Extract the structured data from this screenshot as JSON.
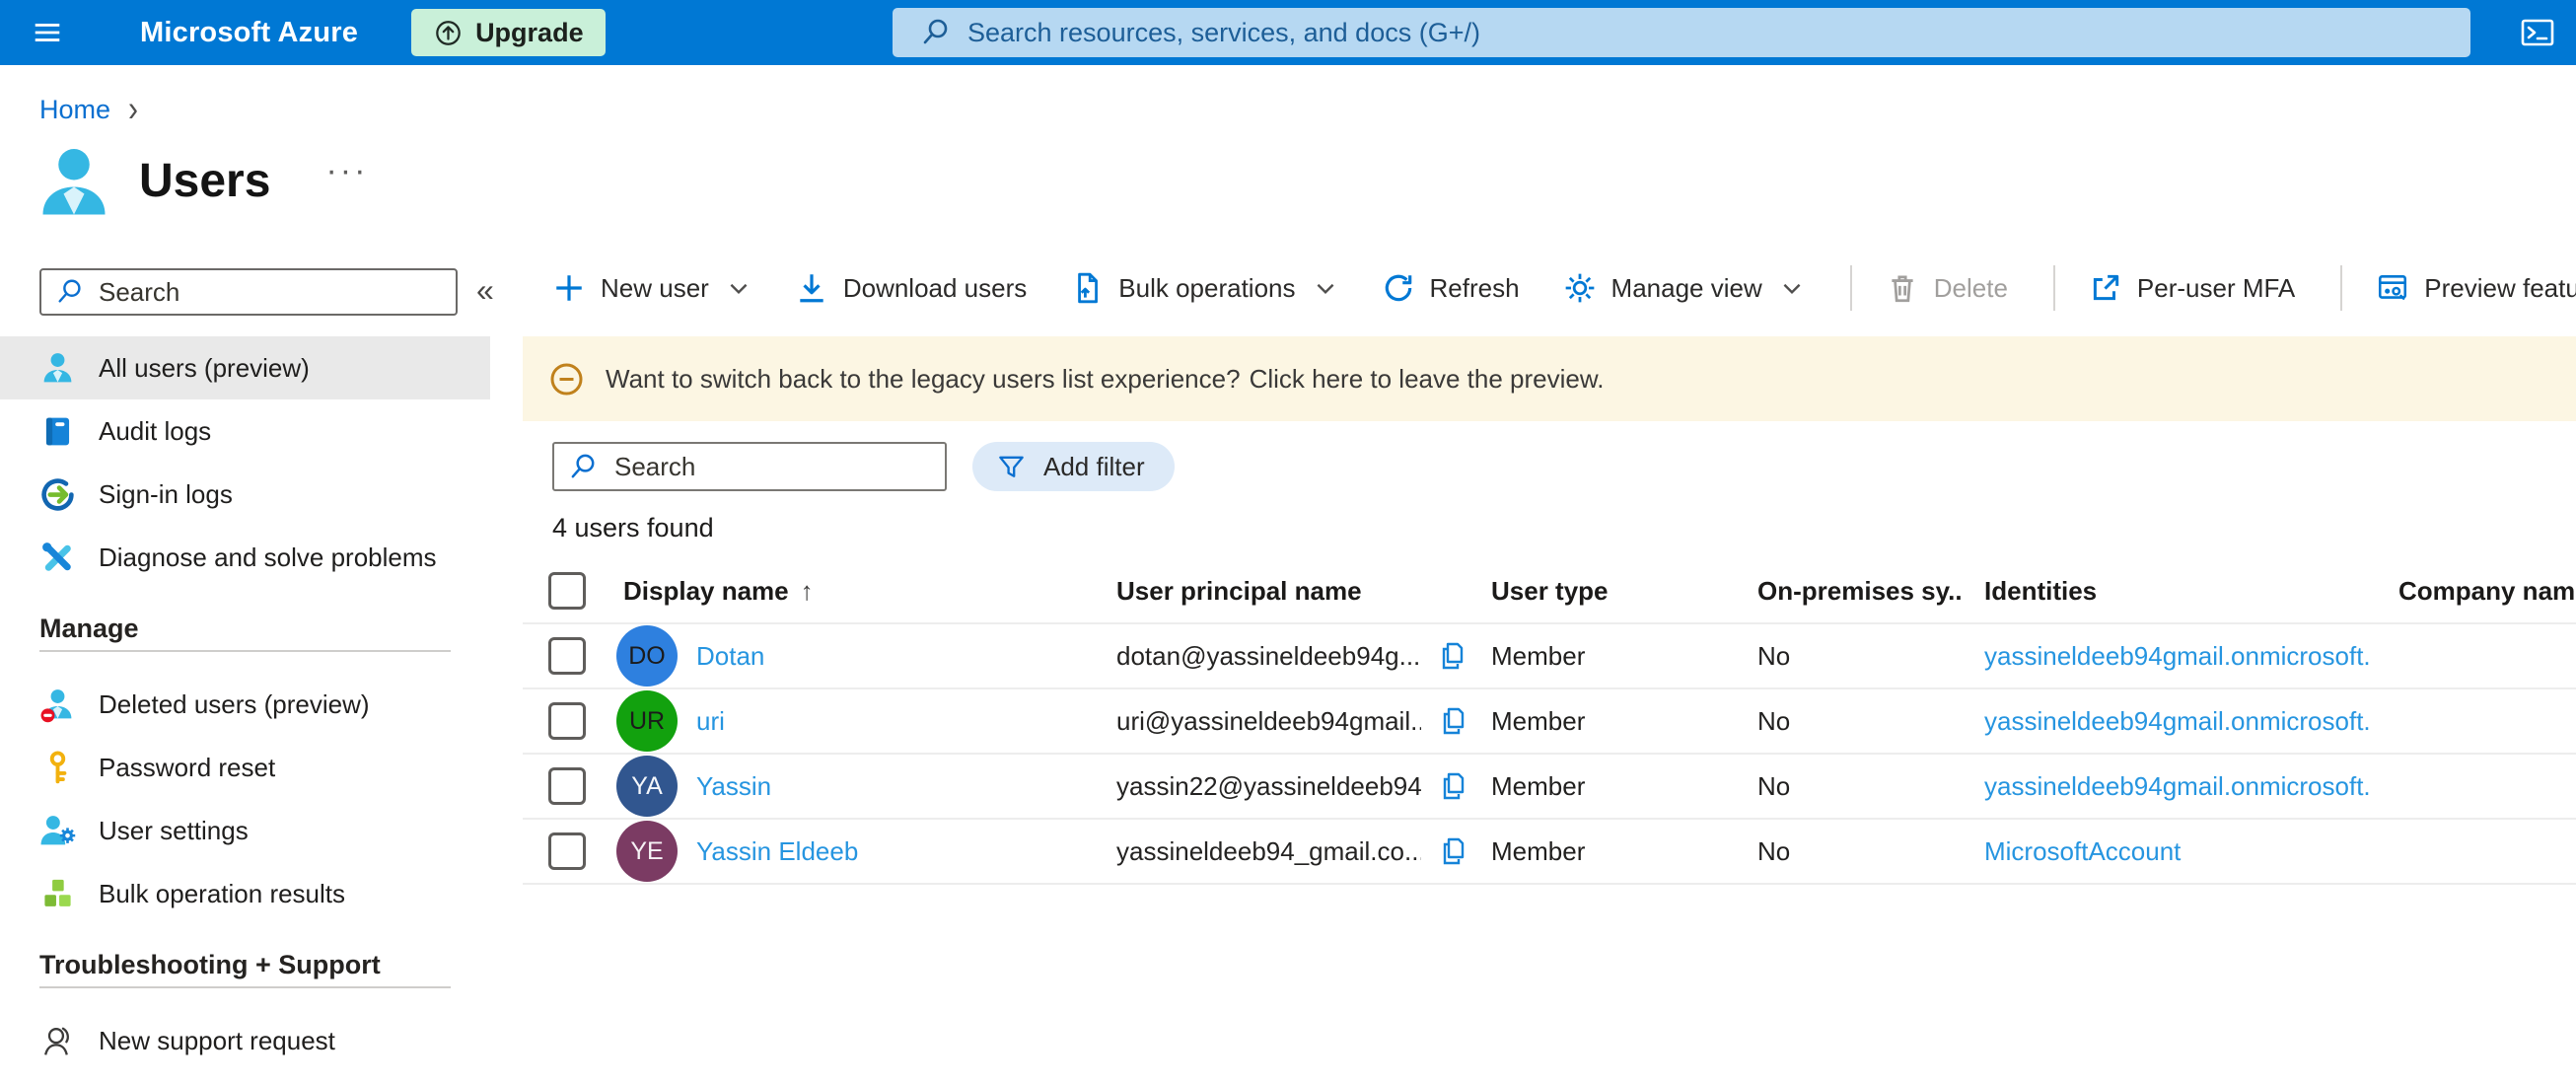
{
  "topbar": {
    "brand": "Microsoft Azure",
    "upgrade_label": "Upgrade",
    "search_placeholder": "Search resources, services, and docs (G+/)"
  },
  "breadcrumb": {
    "home": "Home",
    "separator": "›"
  },
  "page": {
    "title": "Users",
    "menu_glyph": "···"
  },
  "sidebar": {
    "search_placeholder": "Search",
    "collapse_glyph": "«",
    "primary_items": [
      {
        "label": "All users (preview)",
        "icon": "all-users-icon",
        "selected": true
      },
      {
        "label": "Audit logs",
        "icon": "audit-logs-icon"
      },
      {
        "label": "Sign-in logs",
        "icon": "sign-in-logs-icon"
      },
      {
        "label": "Diagnose and solve problems",
        "icon": "diagnose-icon"
      }
    ],
    "manage_header": "Manage",
    "manage_items": [
      {
        "label": "Deleted users (preview)",
        "icon": "deleted-users-icon"
      },
      {
        "label": "Password reset",
        "icon": "password-reset-icon"
      },
      {
        "label": "User settings",
        "icon": "user-settings-icon"
      },
      {
        "label": "Bulk operation results",
        "icon": "bulk-results-icon"
      }
    ],
    "support_header": "Troubleshooting + Support",
    "support_items": [
      {
        "label": "New support request",
        "icon": "support-request-icon"
      }
    ]
  },
  "toolbar": {
    "buttons": [
      {
        "label": "New user",
        "icon": "add-icon",
        "chevron": true
      },
      {
        "label": "Download users",
        "icon": "download-icon"
      },
      {
        "label": "Bulk operations",
        "icon": "bulk-operations-icon",
        "chevron": true
      },
      {
        "label": "Refresh",
        "icon": "refresh-icon"
      },
      {
        "label": "Manage view",
        "icon": "gear-icon",
        "chevron": true
      },
      {
        "label": "Delete",
        "icon": "trash-icon",
        "disabled": true,
        "divider_before": true
      },
      {
        "label": "Per-user MFA",
        "icon": "external-link-icon",
        "divider_before": true
      },
      {
        "label": "Preview features",
        "icon": "preview-features-icon",
        "divider_before": true
      }
    ]
  },
  "banner": {
    "message": "Want to switch back to the legacy users list experience?",
    "link": "Click here to leave the preview."
  },
  "filters": {
    "search_placeholder": "Search",
    "add_filter_label": "Add filter"
  },
  "results_count": "4 users found",
  "table": {
    "columns": [
      {
        "label": "Display name",
        "sort": "↑"
      },
      {
        "label": "User principal name"
      },
      {
        "label": "User type"
      },
      {
        "label": "On-premises sy..."
      },
      {
        "label": "Identities"
      },
      {
        "label": "Company name"
      }
    ],
    "rows": [
      {
        "initials": "DO",
        "avatar_bg": "#2e80df",
        "avatar_fg": "#1b1b1b",
        "name": "Dotan",
        "upn": "dotan@yassineldeeb94g...",
        "user_type": "Member",
        "on_premises": "No",
        "identity": "yassineldeeb94gmail.onmicrosoft.",
        "company": ""
      },
      {
        "initials": "UR",
        "avatar_bg": "#12a10e",
        "avatar_fg": "#1b1b1b",
        "name": "uri",
        "upn": "uri@yassineldeeb94gmail....",
        "user_type": "Member",
        "on_premises": "No",
        "identity": "yassineldeeb94gmail.onmicrosoft.",
        "company": ""
      },
      {
        "initials": "YA",
        "avatar_bg": "#31568f",
        "avatar_fg": "#f4f7fb",
        "name": "Yassin",
        "upn": "yassin22@yassineldeeb94...",
        "user_type": "Member",
        "on_premises": "No",
        "identity": "yassineldeeb94gmail.onmicrosoft.",
        "company": ""
      },
      {
        "initials": "YE",
        "avatar_bg": "#7b3b63",
        "avatar_fg": "#f6f2f5",
        "name": "Yassin Eldeeb",
        "upn": "yassineldeeb94_gmail.co...",
        "user_type": "Member",
        "on_premises": "No",
        "identity": "MicrosoftAccount",
        "company": ""
      }
    ]
  },
  "colors": {
    "accent": "#0078d4",
    "topbar_search_bg": "#b6d8f2",
    "upgrade_bg": "#c9f0d9",
    "banner_bg": "#fcf6e3",
    "selected_item_bg": "#e9e9e9",
    "table_link": "#2695e0",
    "banner_icon": "#c0811c"
  }
}
